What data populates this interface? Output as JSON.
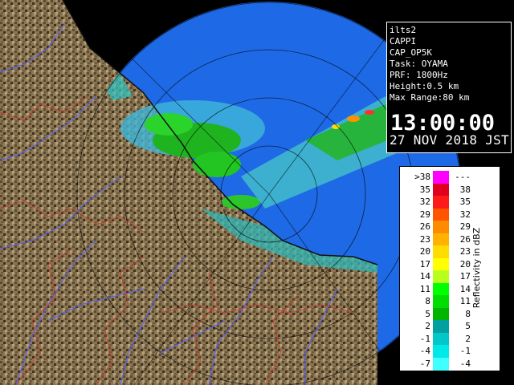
{
  "radar": {
    "site": "ilts2",
    "product": "CAPPI",
    "product_code": "CAP_OP5K",
    "task": "Task: OYAMA",
    "prf": "PRF: 1800Hz",
    "height": "Height:0.5 km",
    "max_range": "Max Range:80 km",
    "time": "13:00:00",
    "date": "27 NOV 2018 JST"
  },
  "legend": {
    "title": "Reflectivity in dBZ",
    "rows": [
      {
        "lo": ">38",
        "hi": "---",
        "color": "#ff00ff"
      },
      {
        "lo": "35",
        "hi": "38",
        "color": "#e0001e"
      },
      {
        "lo": "32",
        "hi": "35",
        "color": "#ff1a1a"
      },
      {
        "lo": "29",
        "hi": "32",
        "color": "#ff5500"
      },
      {
        "lo": "26",
        "hi": "29",
        "color": "#ff8c00"
      },
      {
        "lo": "23",
        "hi": "26",
        "color": "#ffb300"
      },
      {
        "lo": "20",
        "hi": "23",
        "color": "#ffdd00"
      },
      {
        "lo": "17",
        "hi": "20",
        "color": "#ffff00"
      },
      {
        "lo": "14",
        "hi": "17",
        "color": "#b8ff1e"
      },
      {
        "lo": "11",
        "hi": "14",
        "color": "#00ff00"
      },
      {
        "lo": "8",
        "hi": "11",
        "color": "#00dd00"
      },
      {
        "lo": "5",
        "hi": "8",
        "color": "#00b400"
      },
      {
        "lo": "2",
        "hi": "5",
        "color": "#00a0a0"
      },
      {
        "lo": "-1",
        "hi": "2",
        "color": "#00c8c8"
      },
      {
        "lo": "-4",
        "hi": "-1",
        "color": "#00e8e8"
      },
      {
        "lo": "-7",
        "hi": "-4",
        "color": "#40ffff"
      }
    ]
  },
  "colors": {
    "background": "#000000",
    "range_disk": "#1e6ae6",
    "land": "#8a7550",
    "rivers": "#5060ff",
    "boundaries": "#c04030"
  }
}
